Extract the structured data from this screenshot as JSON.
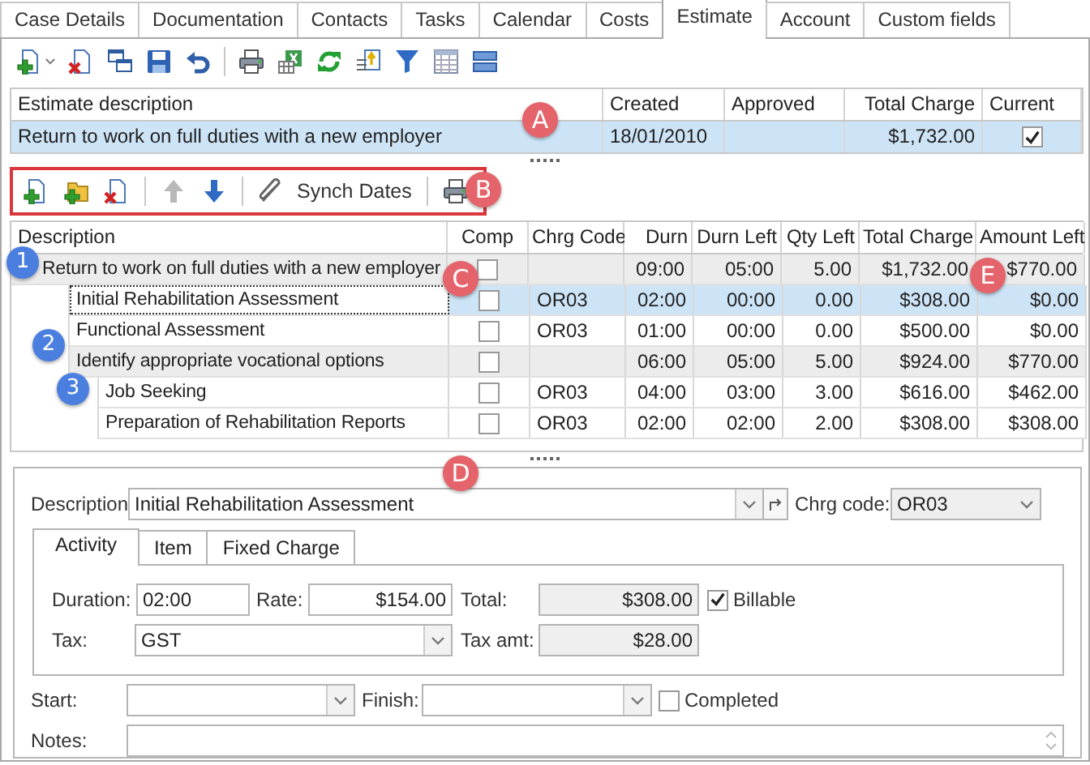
{
  "tabs": [
    {
      "label": "Case Details",
      "selected": false
    },
    {
      "label": "Documentation",
      "selected": false
    },
    {
      "label": "Contacts",
      "selected": false
    },
    {
      "label": "Tasks",
      "selected": false
    },
    {
      "label": "Calendar",
      "selected": false
    },
    {
      "label": "Costs",
      "selected": false
    },
    {
      "label": "Estimate",
      "selected": true
    },
    {
      "label": "Account",
      "selected": false
    },
    {
      "label": "Custom fields",
      "selected": false
    }
  ],
  "estimates": {
    "columns": [
      "Estimate description",
      "Created",
      "Approved",
      "Total Charge",
      "Current"
    ],
    "rows": [
      {
        "description": "Return to work on full duties with a new employer",
        "created": "18/01/2010",
        "total_charge": "$1,732.00",
        "current": true,
        "selected": true
      }
    ]
  },
  "item_toolbar": {
    "synch_dates": "Synch Dates",
    "move_up": {
      "disabled": true
    },
    "move_down": {
      "disabled": false
    }
  },
  "items": {
    "columns": [
      "Description",
      "Comp",
      "Chrg Code",
      "Durn",
      "Durn Left",
      "Qty Left",
      "Total Charge",
      "Amount Left"
    ],
    "rows": [
      {
        "kind": "group",
        "description": "Return to work on full duties with a new employer",
        "comp": false,
        "selected": false,
        "durn": "09:00",
        "durn_left": "05:00",
        "qty_left": "5.00",
        "total_charge": "$1,732.00",
        "amount_left": "$770.00",
        "children": [
          {
            "kind": "task",
            "description": "Initial Rehabilitation Assessment",
            "comp": false,
            "selected": true,
            "chrg_code": "OR03",
            "durn": "02:00",
            "durn_left": "00:00",
            "qty_left": "0.00",
            "total_charge": "$308.00",
            "amount_left": "$0.00"
          },
          {
            "kind": "task",
            "description": "Functional Assessment",
            "comp": false,
            "selected": false,
            "chrg_code": "OR03",
            "durn": "01:00",
            "durn_left": "00:00",
            "qty_left": "0.00",
            "total_charge": "$500.00",
            "amount_left": "$0.00"
          },
          {
            "kind": "group",
            "description": "Identify appropriate vocational options",
            "comp": false,
            "selected": false,
            "durn": "06:00",
            "durn_left": "05:00",
            "qty_left": "5.00",
            "total_charge": "$924.00",
            "amount_left": "$770.00",
            "children": [
              {
                "kind": "task",
                "description": "Job Seeking",
                "comp": false,
                "selected": false,
                "chrg_code": "OR03",
                "durn": "04:00",
                "durn_left": "03:00",
                "qty_left": "3.00",
                "total_charge": "$616.00",
                "amount_left": "$462.00"
              },
              {
                "kind": "task",
                "description": "Preparation of Rehabilitation Reports",
                "comp": false,
                "selected": false,
                "chrg_code": "OR03",
                "durn": "02:00",
                "durn_left": "02:00",
                "qty_left": "2.00",
                "total_charge": "$308.00",
                "amount_left": "$308.00"
              }
            ]
          }
        ]
      }
    ]
  },
  "detail": {
    "description_label": "Description",
    "description": "Initial Rehabilitation Assessment",
    "chrg_code_label": "Chrg code:",
    "chrg_code": "OR03",
    "chrg_code_disabled": true,
    "tabs": [
      {
        "label": "Activity",
        "selected": true
      },
      {
        "label": "Item",
        "selected": false
      },
      {
        "label": "Fixed Charge",
        "selected": false
      }
    ],
    "duration_label": "Duration:",
    "duration": "02:00",
    "rate_label": "Rate:",
    "rate": "$154.00",
    "total_label": "Total:",
    "total": "$308.00",
    "billable": {
      "label": "Billable",
      "checked": true
    },
    "tax_label": "Tax:",
    "tax": "GST",
    "tax_amt_label": "Tax amt:",
    "tax_amt": "$28.00",
    "start_label": "Start:",
    "finish_label": "Finish:",
    "completed": {
      "label": "Completed",
      "checked": false
    },
    "notes_label": "Notes:"
  },
  "callouts": [
    {
      "label": "A",
      "color": "#e5636a"
    },
    {
      "label": "B",
      "color": "#e5636a"
    },
    {
      "label": "C",
      "color": "#e5636a"
    },
    {
      "label": "D",
      "color": "#e5636a"
    },
    {
      "label": "E",
      "color": "#e5636a"
    },
    {
      "label": "1",
      "color": "#4a7fe0"
    },
    {
      "label": "2",
      "color": "#4a7fe0"
    },
    {
      "label": "3",
      "color": "#4a7fe0"
    }
  ]
}
